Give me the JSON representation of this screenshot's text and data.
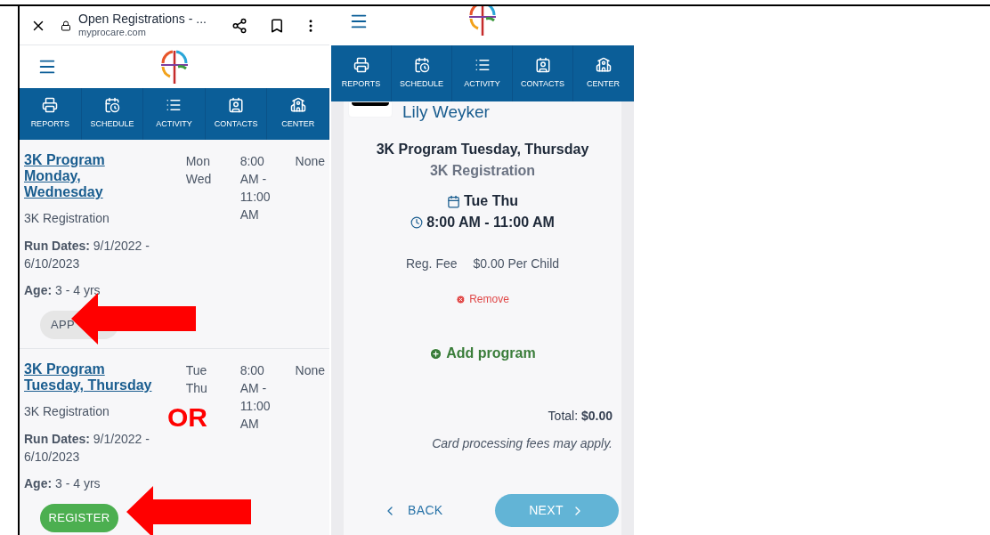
{
  "left_phone": {
    "browser": {
      "title": "Open Registrations - ...",
      "url": "myprocare.com"
    },
    "nav_items": [
      {
        "label": "REPORTS"
      },
      {
        "label": "SCHEDULE"
      },
      {
        "label": "ACTIVITY"
      },
      {
        "label": "CONTACTS"
      },
      {
        "label": "CENTER"
      }
    ],
    "programs": [
      {
        "name": "3K Program Monday, Wednesday",
        "days": "Mon Wed",
        "time": "8:00 AM - 11:00 AM",
        "column_4": "None",
        "registration": "3K Registration",
        "run_dates": "**Run Dates:** 9/1/2022 - 6/10/2023",
        "age": "**Age:** 3 - 4 yrs",
        "button": {
          "kind": "apply",
          "label": "APP"
        }
      },
      {
        "name": "3K Program Tuesday, Thursday",
        "days": "Tue Thu",
        "time": "8:00 AM - 11:00 AM",
        "column_4": "None",
        "registration": "3K Registration",
        "run_dates": "**Run Dates:** 9/1/2022 - 6/10/2023",
        "age": "**Age:** 3 - 4 yrs",
        "button": {
          "kind": "register",
          "label": "REGISTER"
        }
      }
    ]
  },
  "right_phone": {
    "nav_items": [
      {
        "label": "REPORTS"
      },
      {
        "label": "SCHEDULE"
      },
      {
        "label": "ACTIVITY"
      },
      {
        "label": "CONTACTS"
      },
      {
        "label": "CENTER"
      }
    ],
    "child_name": "Lily Weyker",
    "program": "3K Program Tuesday, Thursday",
    "registration": "3K Registration",
    "days": "Tue Thu",
    "time": "8:00 AM - 11:00 AM",
    "fee_label": "Reg. Fee",
    "fee_value": "$0.00 Per Child",
    "remove": "Remove",
    "add_program": "Add program",
    "total": "Total: **$0.00**",
    "note": "Card processing fees may apply.",
    "back": "BACK",
    "next": "NEXT"
  },
  "annotation": {
    "or_text": "OR"
  }
}
